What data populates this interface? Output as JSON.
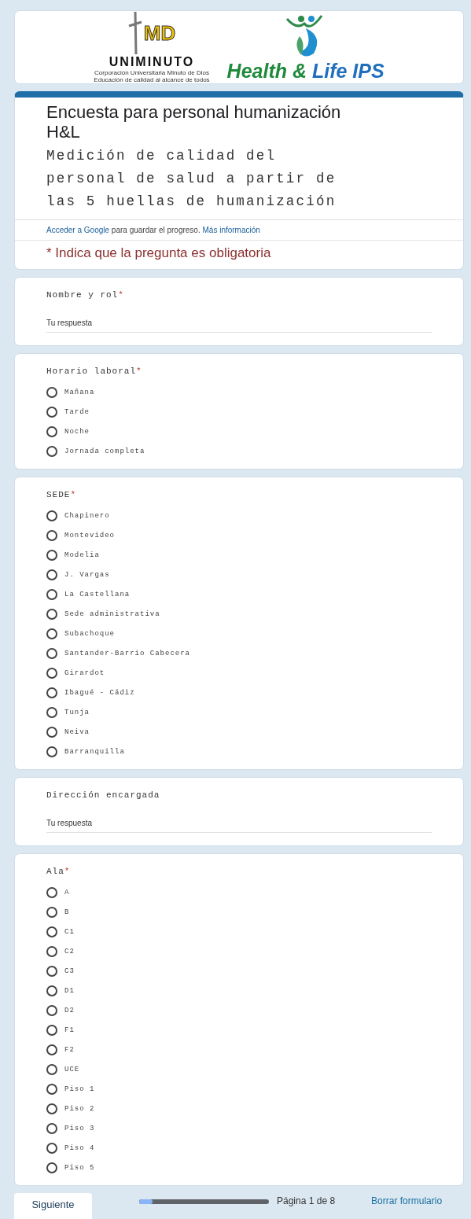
{
  "header": {
    "uniminuto": {
      "mark": "MD",
      "name": "UNIMINUTO",
      "line_1": "Corporación Universitaria Minuto de Dios",
      "line_2": "Educación de calidad al alcance de todos"
    },
    "ips": {
      "name_1": "Health &",
      "name_2": "Life IPS"
    }
  },
  "form": {
    "title": "Encuesta para personal humanización H&L",
    "description": "Medición de calidad del personal de salud a partir de las 5 huellas de humanización",
    "signin_link": "Acceder a Google",
    "signin_text": "para guardar el progreso.",
    "more_link": "Más información",
    "required_note": "* Indica que la pregunta es obligatoria"
  },
  "questions": [
    {
      "kind": "text",
      "label": "Nombre y rol",
      "required_mark": "*",
      "placeholder": "Tu respuesta"
    },
    {
      "kind": "radio",
      "label": "Horario laboral",
      "required_mark": "*",
      "options": [
        {
          "label": "Mañana",
          "selected": false
        },
        {
          "label": "Tarde",
          "selected": false
        },
        {
          "label": "Noche",
          "selected": false
        },
        {
          "label": "Jornada completa",
          "selected": false
        }
      ]
    },
    {
      "kind": "radio",
      "label": "SEDE",
      "required_mark": "*",
      "options": [
        {
          "label": "Chapinero",
          "selected": false
        },
        {
          "label": "Montevideo",
          "selected": false
        },
        {
          "label": "Modelia",
          "selected": false
        },
        {
          "label": "J. Vargas",
          "selected": false
        },
        {
          "label": "La Castellana",
          "selected": false
        },
        {
          "label": "Sede administrativa",
          "selected": false
        },
        {
          "label": "Subachoque",
          "selected": false
        },
        {
          "label": "Santander-Barrio Cabecera",
          "selected": false
        },
        {
          "label": "Girardot",
          "selected": false
        },
        {
          "label": "Ibagué - Cádiz",
          "selected": false
        },
        {
          "label": "Tunja",
          "selected": false
        },
        {
          "label": "Neiva",
          "selected": false
        },
        {
          "label": "Barranquilla",
          "selected": false
        }
      ]
    },
    {
      "kind": "text",
      "label": "Dirección encargada",
      "placeholder": "Tu respuesta"
    },
    {
      "kind": "radio",
      "label": "Ala",
      "required_mark": "*",
      "options": [
        {
          "label": "A",
          "selected": false
        },
        {
          "label": "B",
          "selected": false
        },
        {
          "label": "C1",
          "selected": false
        },
        {
          "label": "C2",
          "selected": false
        },
        {
          "label": "C3",
          "selected": false
        },
        {
          "label": "D1",
          "selected": false
        },
        {
          "label": "D2",
          "selected": false
        },
        {
          "label": "F1",
          "selected": false
        },
        {
          "label": "F2",
          "selected": false
        },
        {
          "label": "UCE",
          "selected": false
        },
        {
          "label": "Piso 1",
          "selected": false
        },
        {
          "label": "Piso 2",
          "selected": false
        },
        {
          "label": "Piso 3",
          "selected": false
        },
        {
          "label": "Piso 4",
          "selected": false
        },
        {
          "label": "Piso 5",
          "selected": false
        }
      ]
    }
  ],
  "footer": {
    "next_button": "Siguiente",
    "progress": {
      "level": 0.1
    },
    "page_label": "Página 1 de 8",
    "clear_link": "Borrar formulario"
  }
}
